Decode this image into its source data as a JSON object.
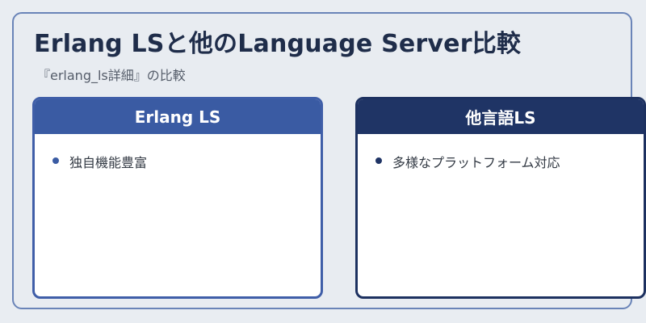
{
  "slide": {
    "title": "Erlang LSと他のLanguage Server比較",
    "subtitle": "『erlang_ls詳細』の比較"
  },
  "cards": [
    {
      "header": "Erlang LS",
      "items": [
        "独自機能豊富"
      ]
    },
    {
      "header": "他言語LS",
      "items": [
        "多様なプラットフォーム対応"
      ]
    }
  ],
  "colors": {
    "left_accent": "#3a5ba3",
    "right_accent": "#1f3465",
    "frame_border": "#6a84b8",
    "background": "#e8ecf1"
  }
}
